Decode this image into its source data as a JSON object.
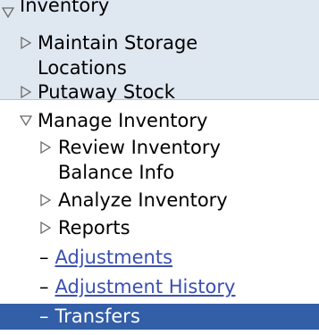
{
  "nav": {
    "inventory_label": "Inventory",
    "maintain_storage_line1": "Maintain Storage",
    "maintain_storage_line2": "Locations",
    "putaway_stock": "Putaway Stock",
    "manage_inventory": "Manage Inventory",
    "review_inventory_line1": "Review Inventory",
    "review_inventory_line2": "Balance Info",
    "analyze_inventory": "Analyze Inventory",
    "reports": "Reports",
    "adjustments": "Adjustments",
    "adjustment_history": "Adjustment History",
    "transfers": "Transfers",
    "dash": "–"
  },
  "colors": {
    "top_panel_bg": "#dfe7f1",
    "link": "#3b4fb0",
    "selected_bg": "#335ea8",
    "selected_text": "#ffffff"
  },
  "icons": {
    "expanded": "triangle-down-icon",
    "collapsed": "triangle-right-icon"
  }
}
